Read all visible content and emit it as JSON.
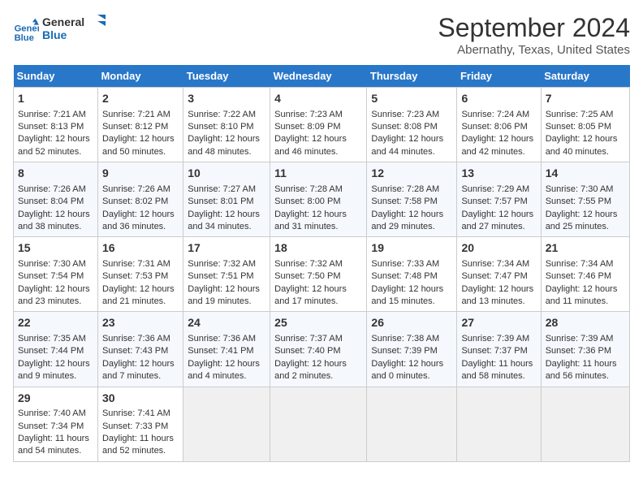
{
  "header": {
    "logo_line1": "General",
    "logo_line2": "Blue",
    "title": "September 2024",
    "subtitle": "Abernathy, Texas, United States"
  },
  "days_of_week": [
    "Sunday",
    "Monday",
    "Tuesday",
    "Wednesday",
    "Thursday",
    "Friday",
    "Saturday"
  ],
  "weeks": [
    [
      {
        "day": "1",
        "sunrise": "Sunrise: 7:21 AM",
        "sunset": "Sunset: 8:13 PM",
        "daylight": "Daylight: 12 hours and 52 minutes."
      },
      {
        "day": "2",
        "sunrise": "Sunrise: 7:21 AM",
        "sunset": "Sunset: 8:12 PM",
        "daylight": "Daylight: 12 hours and 50 minutes."
      },
      {
        "day": "3",
        "sunrise": "Sunrise: 7:22 AM",
        "sunset": "Sunset: 8:10 PM",
        "daylight": "Daylight: 12 hours and 48 minutes."
      },
      {
        "day": "4",
        "sunrise": "Sunrise: 7:23 AM",
        "sunset": "Sunset: 8:09 PM",
        "daylight": "Daylight: 12 hours and 46 minutes."
      },
      {
        "day": "5",
        "sunrise": "Sunrise: 7:23 AM",
        "sunset": "Sunset: 8:08 PM",
        "daylight": "Daylight: 12 hours and 44 minutes."
      },
      {
        "day": "6",
        "sunrise": "Sunrise: 7:24 AM",
        "sunset": "Sunset: 8:06 PM",
        "daylight": "Daylight: 12 hours and 42 minutes."
      },
      {
        "day": "7",
        "sunrise": "Sunrise: 7:25 AM",
        "sunset": "Sunset: 8:05 PM",
        "daylight": "Daylight: 12 hours and 40 minutes."
      }
    ],
    [
      {
        "day": "8",
        "sunrise": "Sunrise: 7:26 AM",
        "sunset": "Sunset: 8:04 PM",
        "daylight": "Daylight: 12 hours and 38 minutes."
      },
      {
        "day": "9",
        "sunrise": "Sunrise: 7:26 AM",
        "sunset": "Sunset: 8:02 PM",
        "daylight": "Daylight: 12 hours and 36 minutes."
      },
      {
        "day": "10",
        "sunrise": "Sunrise: 7:27 AM",
        "sunset": "Sunset: 8:01 PM",
        "daylight": "Daylight: 12 hours and 34 minutes."
      },
      {
        "day": "11",
        "sunrise": "Sunrise: 7:28 AM",
        "sunset": "Sunset: 8:00 PM",
        "daylight": "Daylight: 12 hours and 31 minutes."
      },
      {
        "day": "12",
        "sunrise": "Sunrise: 7:28 AM",
        "sunset": "Sunset: 7:58 PM",
        "daylight": "Daylight: 12 hours and 29 minutes."
      },
      {
        "day": "13",
        "sunrise": "Sunrise: 7:29 AM",
        "sunset": "Sunset: 7:57 PM",
        "daylight": "Daylight: 12 hours and 27 minutes."
      },
      {
        "day": "14",
        "sunrise": "Sunrise: 7:30 AM",
        "sunset": "Sunset: 7:55 PM",
        "daylight": "Daylight: 12 hours and 25 minutes."
      }
    ],
    [
      {
        "day": "15",
        "sunrise": "Sunrise: 7:30 AM",
        "sunset": "Sunset: 7:54 PM",
        "daylight": "Daylight: 12 hours and 23 minutes."
      },
      {
        "day": "16",
        "sunrise": "Sunrise: 7:31 AM",
        "sunset": "Sunset: 7:53 PM",
        "daylight": "Daylight: 12 hours and 21 minutes."
      },
      {
        "day": "17",
        "sunrise": "Sunrise: 7:32 AM",
        "sunset": "Sunset: 7:51 PM",
        "daylight": "Daylight: 12 hours and 19 minutes."
      },
      {
        "day": "18",
        "sunrise": "Sunrise: 7:32 AM",
        "sunset": "Sunset: 7:50 PM",
        "daylight": "Daylight: 12 hours and 17 minutes."
      },
      {
        "day": "19",
        "sunrise": "Sunrise: 7:33 AM",
        "sunset": "Sunset: 7:48 PM",
        "daylight": "Daylight: 12 hours and 15 minutes."
      },
      {
        "day": "20",
        "sunrise": "Sunrise: 7:34 AM",
        "sunset": "Sunset: 7:47 PM",
        "daylight": "Daylight: 12 hours and 13 minutes."
      },
      {
        "day": "21",
        "sunrise": "Sunrise: 7:34 AM",
        "sunset": "Sunset: 7:46 PM",
        "daylight": "Daylight: 12 hours and 11 minutes."
      }
    ],
    [
      {
        "day": "22",
        "sunrise": "Sunrise: 7:35 AM",
        "sunset": "Sunset: 7:44 PM",
        "daylight": "Daylight: 12 hours and 9 minutes."
      },
      {
        "day": "23",
        "sunrise": "Sunrise: 7:36 AM",
        "sunset": "Sunset: 7:43 PM",
        "daylight": "Daylight: 12 hours and 7 minutes."
      },
      {
        "day": "24",
        "sunrise": "Sunrise: 7:36 AM",
        "sunset": "Sunset: 7:41 PM",
        "daylight": "Daylight: 12 hours and 4 minutes."
      },
      {
        "day": "25",
        "sunrise": "Sunrise: 7:37 AM",
        "sunset": "Sunset: 7:40 PM",
        "daylight": "Daylight: 12 hours and 2 minutes."
      },
      {
        "day": "26",
        "sunrise": "Sunrise: 7:38 AM",
        "sunset": "Sunset: 7:39 PM",
        "daylight": "Daylight: 12 hours and 0 minutes."
      },
      {
        "day": "27",
        "sunrise": "Sunrise: 7:39 AM",
        "sunset": "Sunset: 7:37 PM",
        "daylight": "Daylight: 11 hours and 58 minutes."
      },
      {
        "day": "28",
        "sunrise": "Sunrise: 7:39 AM",
        "sunset": "Sunset: 7:36 PM",
        "daylight": "Daylight: 11 hours and 56 minutes."
      }
    ],
    [
      {
        "day": "29",
        "sunrise": "Sunrise: 7:40 AM",
        "sunset": "Sunset: 7:34 PM",
        "daylight": "Daylight: 11 hours and 54 minutes."
      },
      {
        "day": "30",
        "sunrise": "Sunrise: 7:41 AM",
        "sunset": "Sunset: 7:33 PM",
        "daylight": "Daylight: 11 hours and 52 minutes."
      },
      null,
      null,
      null,
      null,
      null
    ]
  ]
}
